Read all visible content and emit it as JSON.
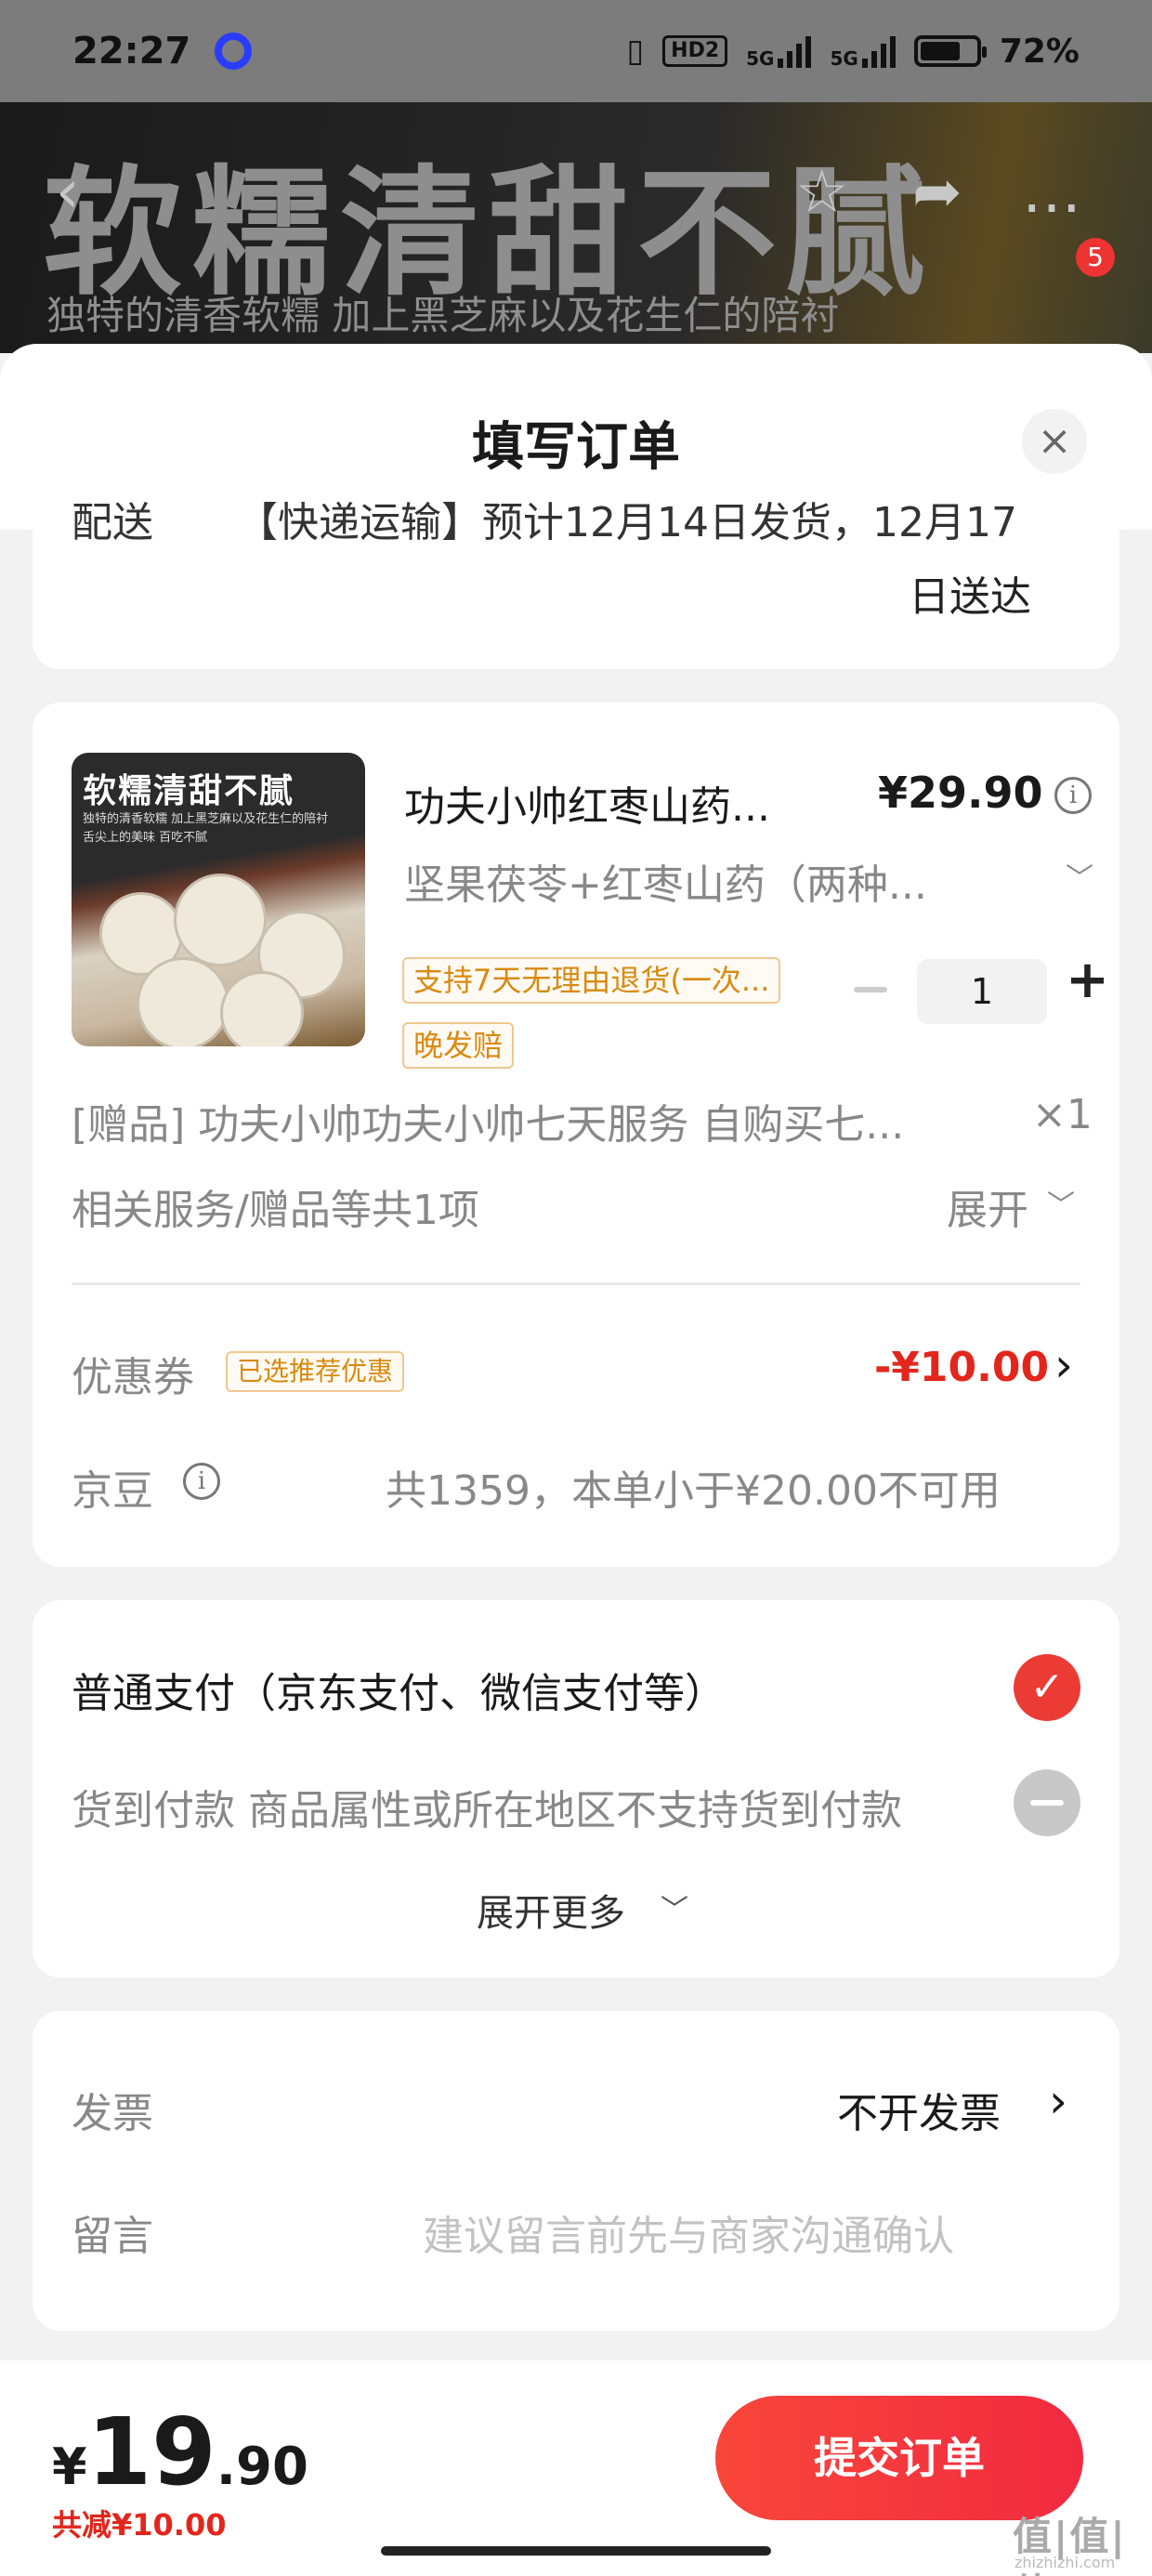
{
  "status_bar": {
    "time": "22:27",
    "hd_label": "HD2",
    "net1_label": "5G",
    "net2_label": "5G",
    "battery": "72%",
    "battery_level": 0.72
  },
  "banner": {
    "headline": "软糯清甜不腻",
    "subline": "独特的清香软糯 加上黑芝麻以及花生仁的陪衬",
    "cart_badge": "5",
    "icons": [
      "back-arrow-icon",
      "star-icon",
      "share-icon",
      "more-icon"
    ]
  },
  "sheet": {
    "title": "填写订单",
    "close_symbol": "×"
  },
  "delivery": {
    "label_partial": "配送",
    "method_partial": "【快递运输】预计12月14日发货，12月17",
    "date_end": "日送达"
  },
  "product": {
    "image_title": "软糯清甜不腻",
    "image_caption": "独特的清香软糯 加上黑芝麻以及花生仁的陪衬\n舌尖上的美味 百吃不腻",
    "name": "功夫小帅红枣山药...",
    "price": "¥29.90",
    "spec": "坚果茯苓+红枣山药（两种...",
    "return_tag": "支持7天无理由退货(一次...",
    "late_tag": "晚发赔",
    "quantity": "1",
    "plus": "+"
  },
  "gift": {
    "text": "[赠品]  功夫小帅功夫小帅七天服务 自购买七...",
    "count": "×1"
  },
  "services": {
    "summary": "相关服务/赠品等共1项",
    "expand_label": "展开"
  },
  "coupon": {
    "label": "优惠券",
    "tag": "已选推荐优惠",
    "amount": "-¥10.00",
    "arrow": "›"
  },
  "jingdou": {
    "label": "京豆",
    "info": "共1359，本单小于¥20.00不可用"
  },
  "payment": {
    "options": [
      {
        "label": "普通支付（京东支付、微信支付等）",
        "selected": true
      },
      {
        "label": "货到付款  商品属性或所在地区不支持货到付款",
        "selected": false
      }
    ],
    "expand_more": "展开更多"
  },
  "invoice": {
    "label": "发票",
    "value": "不开发票",
    "arrow": "›"
  },
  "message": {
    "label": "留言",
    "placeholder": "建议留言前先与商家沟通确认"
  },
  "footer": {
    "currency": "¥",
    "total_int": "19",
    "total_dec": ".90",
    "reduced": "共减¥10.00",
    "submit": "提交订单"
  },
  "watermark": {
    "text": "值|值|值",
    "sub": "zhizhizhi.com"
  },
  "colors": {
    "accent": "#ec3b35",
    "tag_orange": "#d98a10"
  }
}
